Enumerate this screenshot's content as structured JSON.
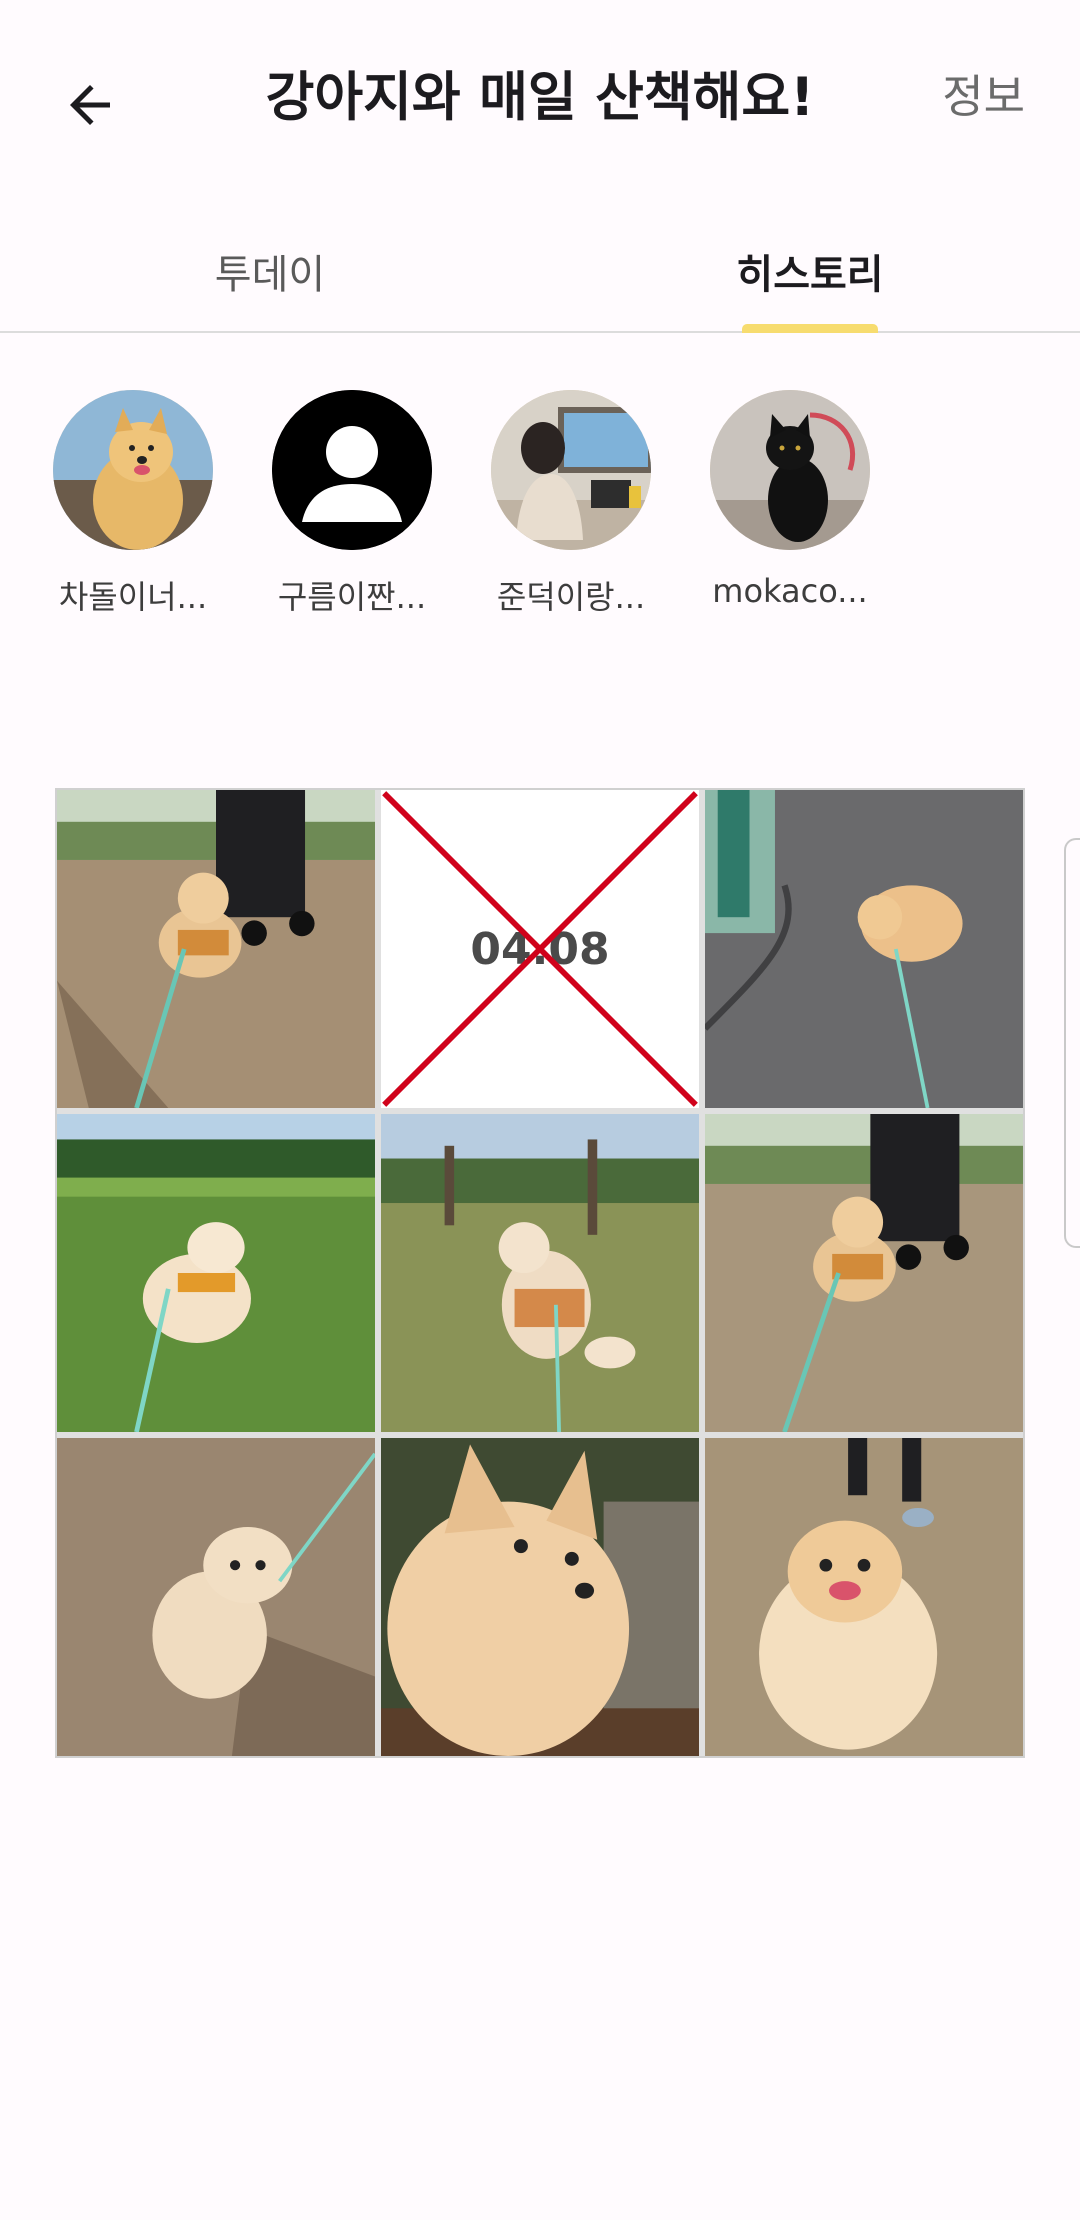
{
  "header": {
    "title": "강아지와 매일 산책해요!",
    "info_label": "정보"
  },
  "tabs": [
    {
      "label": "투데이",
      "active": false
    },
    {
      "label": "히스토리",
      "active": true
    }
  ],
  "colors": {
    "accent": "#f7dc6f",
    "missing_x": "#d0021b"
  },
  "members": [
    {
      "name": "차돌이너...",
      "avatar": "pomeranian-photo"
    },
    {
      "name": "구름이짠...",
      "avatar": "default-person-icon"
    },
    {
      "name": "준덕이랑...",
      "avatar": "person-laptop-photo"
    },
    {
      "name": "mokaco...",
      "avatar": "black-cat-photo"
    }
  ],
  "history": [
    {
      "type": "photo",
      "subject": "dog-park-stroller"
    },
    {
      "type": "missing",
      "date": "04.08"
    },
    {
      "type": "photo",
      "subject": "dog-walking-street"
    },
    {
      "type": "photo",
      "subject": "dog-grass-park"
    },
    {
      "type": "photo",
      "subject": "dog-sitting-back"
    },
    {
      "type": "photo",
      "subject": "dog-park-stroller"
    },
    {
      "type": "photo",
      "subject": "dog-lying-dirt"
    },
    {
      "type": "photo",
      "subject": "dog-closeup-face"
    },
    {
      "type": "photo",
      "subject": "dog-smiling-front"
    }
  ]
}
